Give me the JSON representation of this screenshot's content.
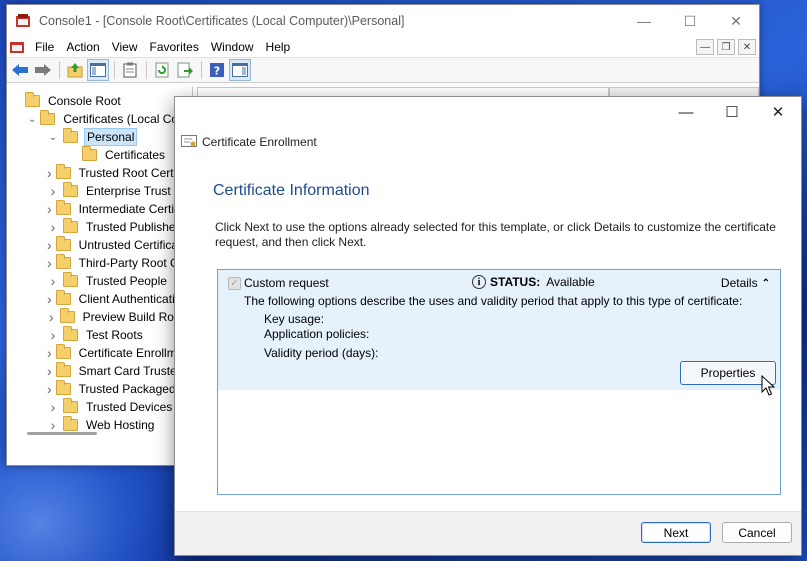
{
  "console": {
    "title": "Console1 - [Console Root\\Certificates (Local Computer)\\Personal]",
    "menu": [
      "File",
      "Action",
      "View",
      "Favorites",
      "Window",
      "Help"
    ],
    "tree": [
      {
        "label": "Console Root",
        "indent": 0,
        "expander": "",
        "selected": false
      },
      {
        "label": "Certificates (Local Computer)",
        "indent": 1,
        "expander": "v",
        "selected": false
      },
      {
        "label": "Personal",
        "indent": 2,
        "expander": "v",
        "selected": true
      },
      {
        "label": "Certificates",
        "indent": 3,
        "expander": "",
        "selected": false
      },
      {
        "label": "Trusted Root Certification Authorities",
        "indent": 2,
        "expander": ">",
        "selected": false
      },
      {
        "label": "Enterprise Trust",
        "indent": 2,
        "expander": ">",
        "selected": false
      },
      {
        "label": "Intermediate Certification Authorities",
        "indent": 2,
        "expander": ">",
        "selected": false
      },
      {
        "label": "Trusted Publishers",
        "indent": 2,
        "expander": ">",
        "selected": false
      },
      {
        "label": "Untrusted Certificates",
        "indent": 2,
        "expander": ">",
        "selected": false
      },
      {
        "label": "Third-Party Root Certification Authorities",
        "indent": 2,
        "expander": ">",
        "selected": false
      },
      {
        "label": "Trusted People",
        "indent": 2,
        "expander": ">",
        "selected": false
      },
      {
        "label": "Client Authentication Issuers",
        "indent": 2,
        "expander": ">",
        "selected": false
      },
      {
        "label": "Preview Build Roots",
        "indent": 2,
        "expander": ">",
        "selected": false
      },
      {
        "label": "Test Roots",
        "indent": 2,
        "expander": ">",
        "selected": false
      },
      {
        "label": "Certificate Enrollment Requests",
        "indent": 2,
        "expander": ">",
        "selected": false
      },
      {
        "label": "Smart Card Trusted Roots",
        "indent": 2,
        "expander": ">",
        "selected": false
      },
      {
        "label": "Trusted Packaged App Installation Authorities",
        "indent": 2,
        "expander": ">",
        "selected": false
      },
      {
        "label": "Trusted Devices",
        "indent": 2,
        "expander": ">",
        "selected": false
      },
      {
        "label": "Web Hosting",
        "indent": 2,
        "expander": ">",
        "selected": false
      }
    ]
  },
  "dialog": {
    "window_title": "Certificate Enrollment",
    "section_title": "Certificate Information",
    "intro": "Click Next to use the options already selected for this template, or click Details to customize the certificate request, and then click Next.",
    "request": {
      "name": "Custom request",
      "checked": true,
      "status_label": "STATUS:",
      "status_value": "Available",
      "details_label": "Details",
      "description": "The following options describe the uses and validity period that apply to this type of certificate:",
      "key_usage_label": "Key usage:",
      "app_policies_label": "Application policies:",
      "validity_label": "Validity period (days):",
      "properties_button": "Properties"
    },
    "next_button": "Next",
    "cancel_button": "Cancel"
  }
}
